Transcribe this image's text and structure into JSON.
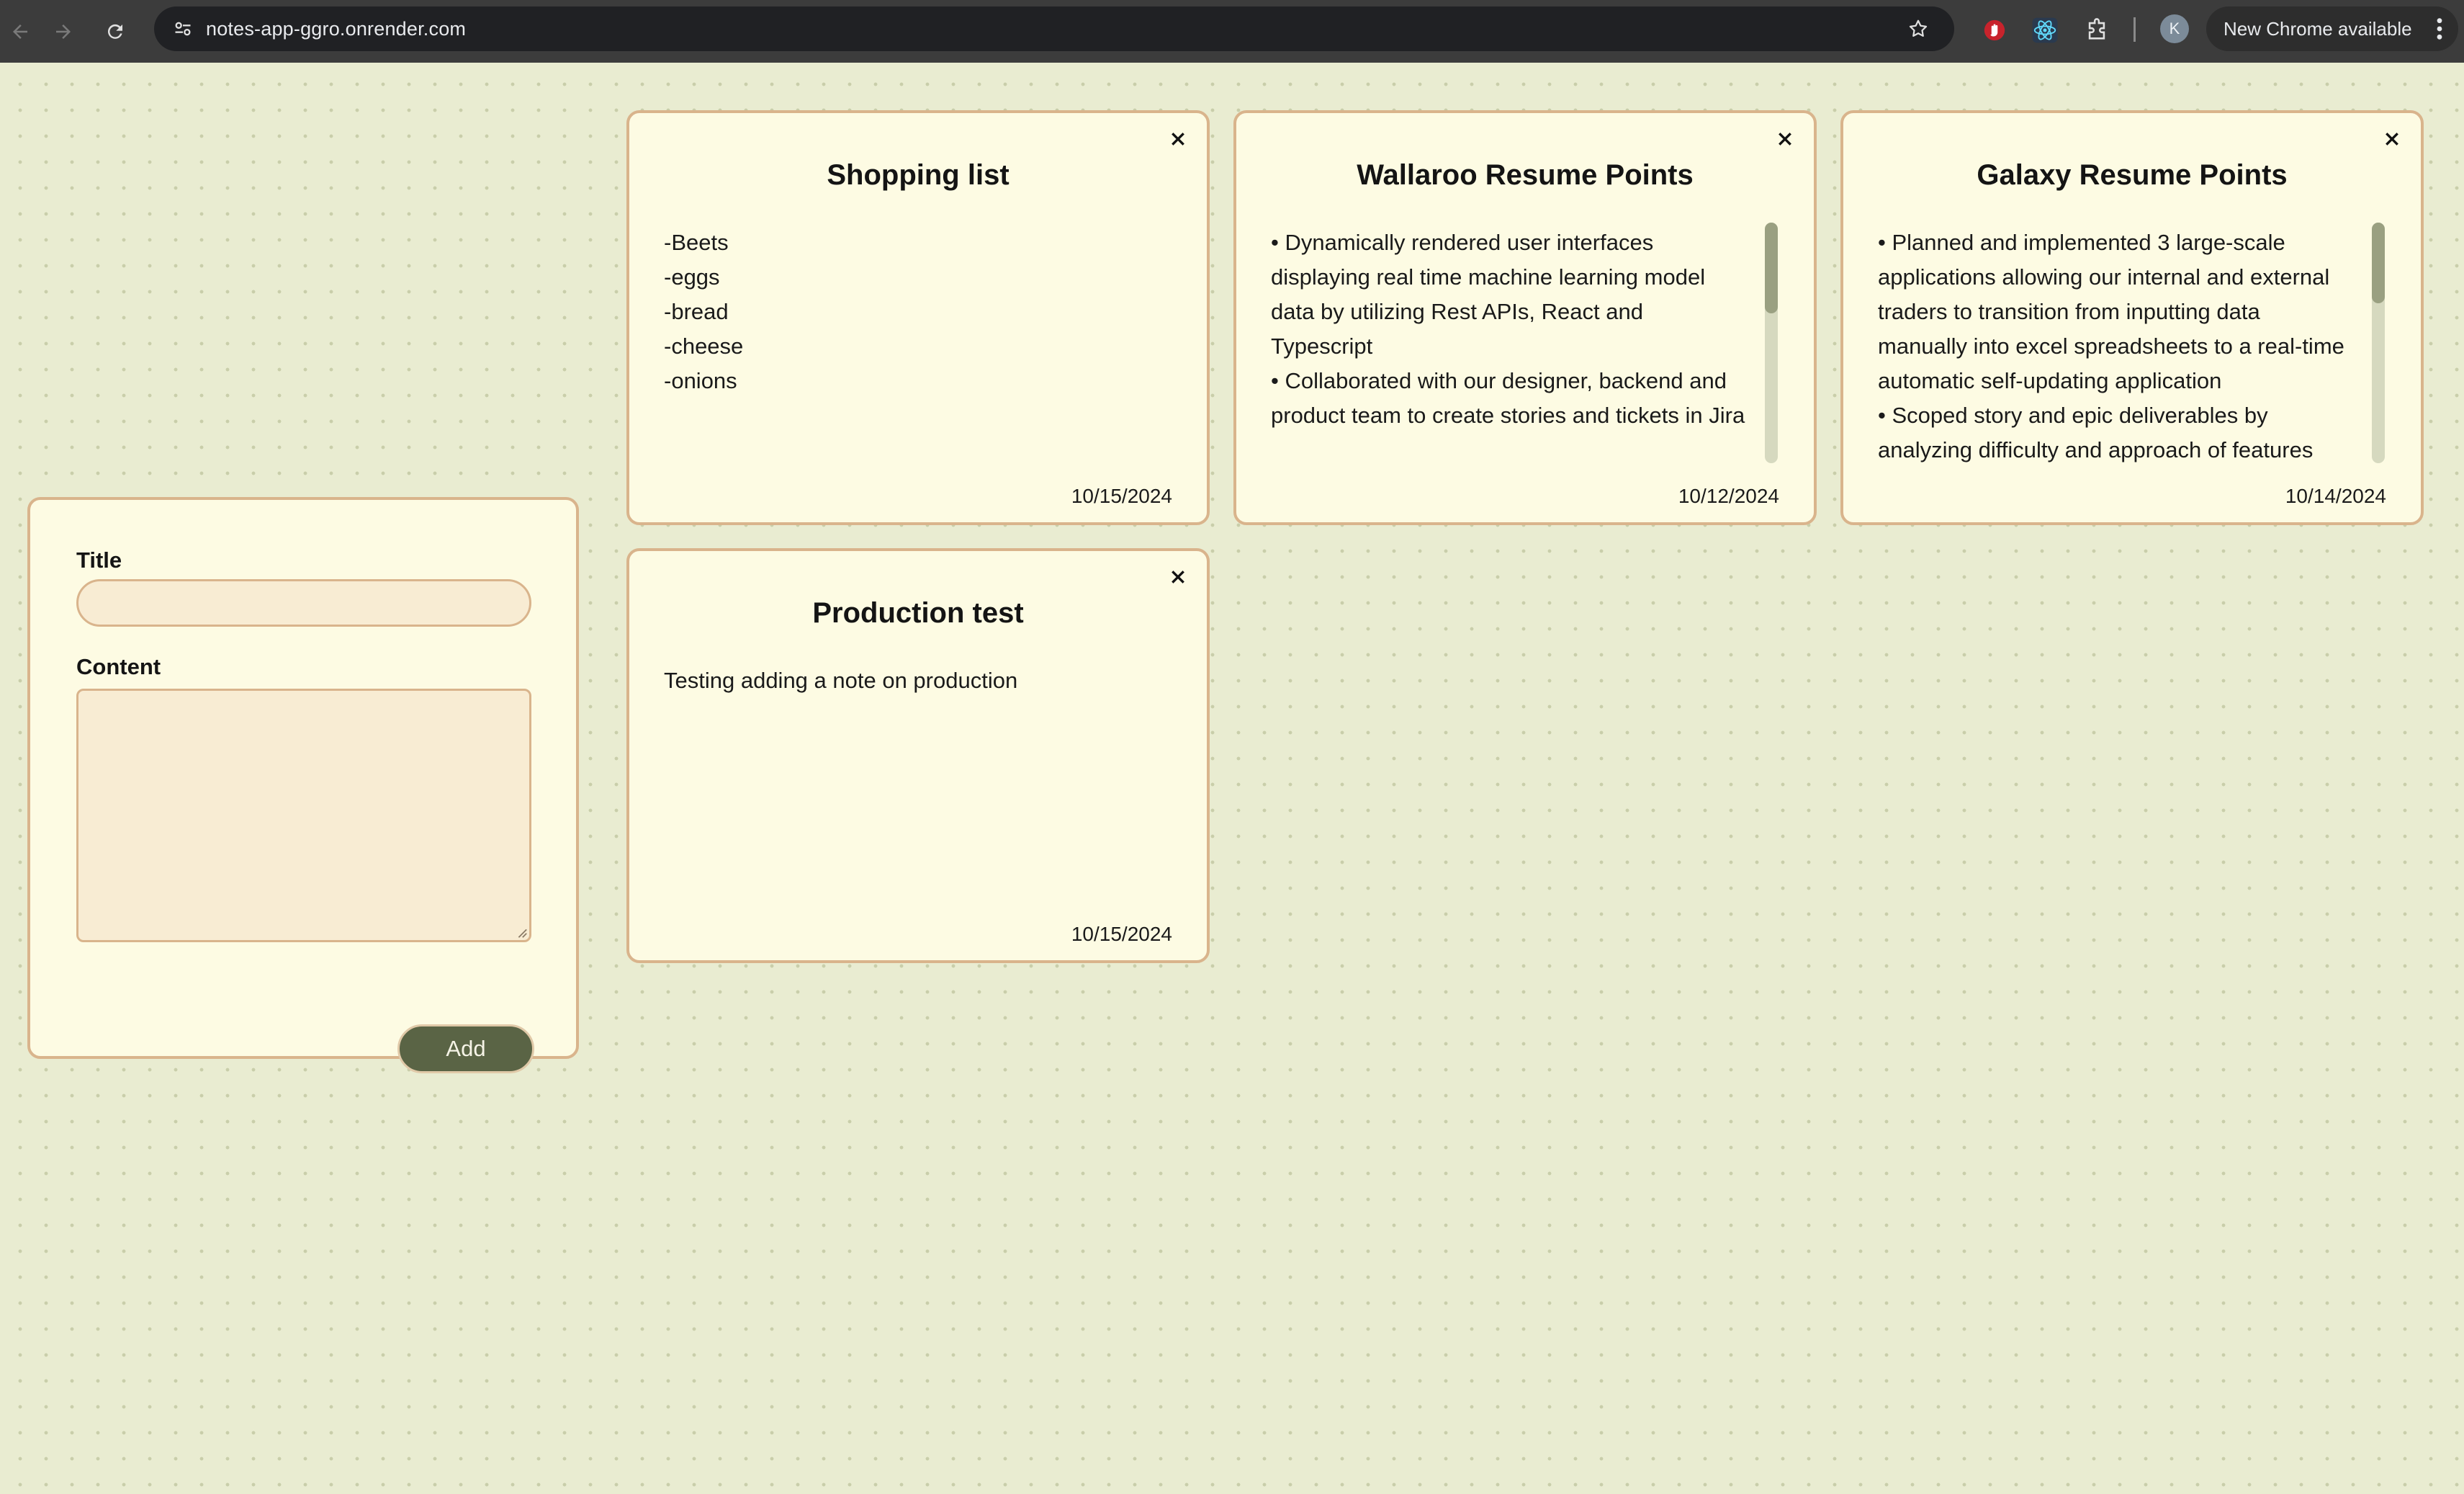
{
  "browser": {
    "url": "notes-app-ggro.onrender.com",
    "profile_initial": "K",
    "update_label": "New Chrome available",
    "icons": [
      "back-icon",
      "forward-icon",
      "reload-icon",
      "site-settings-icon",
      "bookmark-star-icon",
      "extension-red-icon",
      "react-devtools-icon",
      "extensions-puzzle-icon",
      "menu-dots-icon"
    ]
  },
  "form": {
    "title_label": "Title",
    "title_value": "",
    "content_label": "Content",
    "content_value": "",
    "add_label": "Add"
  },
  "notes": [
    {
      "title": "Shopping list",
      "content": "-Beets\n-eggs\n-bread\n-cheese\n-onions",
      "date": "10/15/2024",
      "scrollable": false
    },
    {
      "title": "Wallaroo Resume Points",
      "content": "• Dynamically rendered user interfaces displaying real time machine learning model data by utilizing Rest APIs, React and Typescript\n• Collaborated with our designer, backend and product team to create stories and tickets in Jira",
      "date": "10/12/2024",
      "scrollable": true
    },
    {
      "title": "Galaxy Resume Points",
      "content": "• Planned and implemented 3 large-scale applications allowing our internal and external traders to transition from inputting data manually into excel spreadsheets to a real-time automatic self-updating application\n• Scoped story and epic deliverables by analyzing difficulty and approach of features",
      "date": "10/14/2024",
      "scrollable": true
    },
    {
      "title": "Production test",
      "content": "Testing adding a note on production",
      "date": "10/15/2024",
      "scrollable": false
    }
  ],
  "colors": {
    "page_background": "#e9ecd1",
    "card_background": "#fdfbe3",
    "card_border": "#d9b48c",
    "input_background": "#f8ecd3",
    "button_background": "#5a6445"
  }
}
